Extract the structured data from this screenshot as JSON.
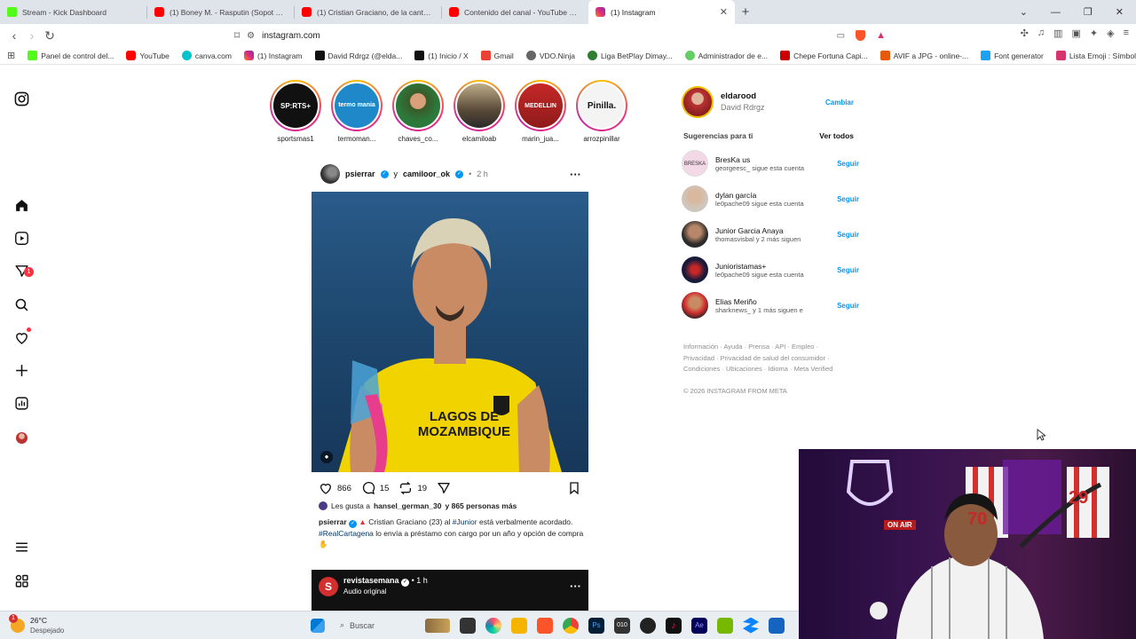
{
  "browser": {
    "tabs": [
      {
        "label": "Stream - Kick Dashboard",
        "icon": "kick-icon"
      },
      {
        "label": "(1) Boney M. - Rasputin (Sopot Festi",
        "icon": "youtube-icon"
      },
      {
        "label": "(1) Cristian Graciano, de la cantera al",
        "icon": "youtube-icon"
      },
      {
        "label": "Contenido del canal - YouTube Studio",
        "icon": "youtube-icon"
      },
      {
        "label": "(1) Instagram",
        "icon": "instagram-icon",
        "active": true
      }
    ],
    "new_tab": "+",
    "url": "instagram.com",
    "bookmarks": [
      "Panel de control del...",
      "YouTube",
      "canva.com",
      "(1) Instagram",
      "David Rdrgz (@elda...",
      "(1) Inicio / X",
      "Gmail",
      "VDO.Ninja",
      "Liga BetPlay Dimay...",
      "Administrador de e...",
      "Chepe Fortuna Capi...",
      "AVIF a JPG - online-...",
      "Font generator",
      "Lista Emoji : Símbol..."
    ]
  },
  "sidebar": {
    "notification_count": "1"
  },
  "stories": [
    {
      "name": "sportsmas1",
      "avatar_text": "SP:RTS+"
    },
    {
      "name": "termoman...",
      "avatar_text": "termo mania"
    },
    {
      "name": "chaves_co...",
      "avatar_text": ""
    },
    {
      "name": "elcamiloab",
      "avatar_text": ""
    },
    {
      "name": "marin_jua...",
      "avatar_text": "MEDELLIN"
    },
    {
      "name": "arrozpinillar",
      "avatar_text": "Pinilla."
    }
  ],
  "post": {
    "author": "psierrar",
    "coauthor_joiner": "y",
    "coauthor": "camiloor_ok",
    "time": "2 h",
    "shirt_text": "LAGOS DE MOZAMBIQUE",
    "likes": "866",
    "comments": "15",
    "reposts": "19",
    "liked_by_prefix": "Les gusta a",
    "liked_by_user": "hansel_german_30",
    "liked_by_suffix": "y 865 personas más",
    "caption_author": "psierrar",
    "caption_1": "Cristian Graciano (23) al",
    "caption_tag1": "#Junior",
    "caption_2": "está verbalmente acordado.",
    "caption_tag2": "#RealCartagena",
    "caption_3": "lo envía a préstamo con cargo por un año y opción de compra"
  },
  "post2": {
    "author": "revistasemana",
    "time": "1 h",
    "audio": "Audio original"
  },
  "profile": {
    "username": "eldarood",
    "full_name": "David Rdrgz",
    "switch_label": "Cambiar"
  },
  "suggestions": {
    "title": "Sugerencias para ti",
    "see_all": "Ver todos",
    "follow_label": "Seguir",
    "items": [
      {
        "name": "BresKa us",
        "sub": "georgeesc_ sigue esta cuenta"
      },
      {
        "name": "dylan garcía",
        "sub": "le0pache09 sigue esta cuenta"
      },
      {
        "name": "Junior Garcia Anaya",
        "sub": "thomasvisbal y 2 más siguen"
      },
      {
        "name": "Junioristamas+",
        "sub": "le0pache09 sigue esta cuenta"
      },
      {
        "name": "Elias Meriño",
        "sub": "sharknews_ y 1 más siguen e"
      }
    ]
  },
  "footer": {
    "line1": "Información · Ayuda · Prensa · API · Empleo ·",
    "line2": "Privacidad · Privacidad de salud del consumidor ·",
    "line3": "Condiciones · Ubicaciones · Idioma · Meta Verified",
    "copyright": "© 2026 INSTAGRAM FROM META"
  },
  "taskbar": {
    "weather_temp": "26°C",
    "weather_desc": "Despejado",
    "weather_badge": "1",
    "search_placeholder": "Buscar"
  },
  "webcam": {
    "on_air": "ON AIR",
    "shirt_70": "70",
    "shirt_29": "29"
  }
}
